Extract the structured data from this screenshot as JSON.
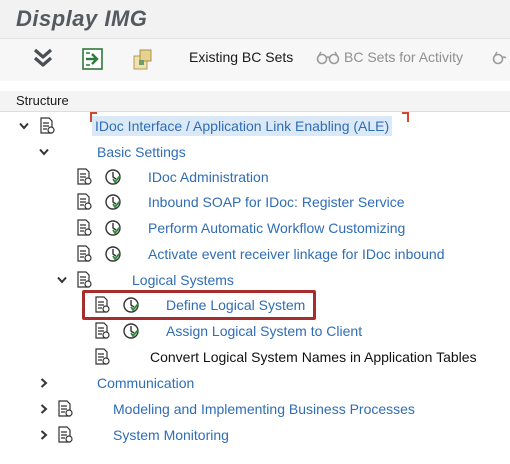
{
  "window": {
    "title": "Display IMG"
  },
  "toolbar": {
    "expand_icon": "double-chevron-down-icon",
    "execute_icon": "execute-icon",
    "bcset_icon": "bc-set-icon",
    "existing_bc_sets": "Existing BC Sets",
    "bc_sets_for_activity": "BC Sets for Activity"
  },
  "structure": {
    "header": "Structure",
    "root": {
      "label": "IDoc Interface / Application Link Enabling (ALE)",
      "expanded": true
    },
    "basic_settings": {
      "label": "Basic Settings",
      "expanded": true
    },
    "items": [
      {
        "label": "IDoc Administration"
      },
      {
        "label": "Inbound SOAP for IDoc: Register Service"
      },
      {
        "label": "Perform Automatic Workflow Customizing"
      },
      {
        "label": "Activate event receiver linkage for IDoc inbound"
      }
    ],
    "logical_systems": {
      "label": "Logical Systems",
      "expanded": true,
      "items": [
        {
          "label": "Define Logical System",
          "highlighted": true
        },
        {
          "label": "Assign Logical System to Client"
        },
        {
          "label": "Convert Logical System Names in Application Tables"
        }
      ]
    },
    "communication": {
      "label": "Communication",
      "expanded": false
    },
    "modeling": {
      "label": "Modeling and Implementing Business Processes",
      "expanded": false
    },
    "monitoring": {
      "label": "System Monitoring",
      "expanded": false
    }
  },
  "colors": {
    "link": "#2f6db5",
    "highlight_border": "#a72d2d",
    "selection_bracket": "#d0482f",
    "selection_fill": "#dbe8f6"
  }
}
